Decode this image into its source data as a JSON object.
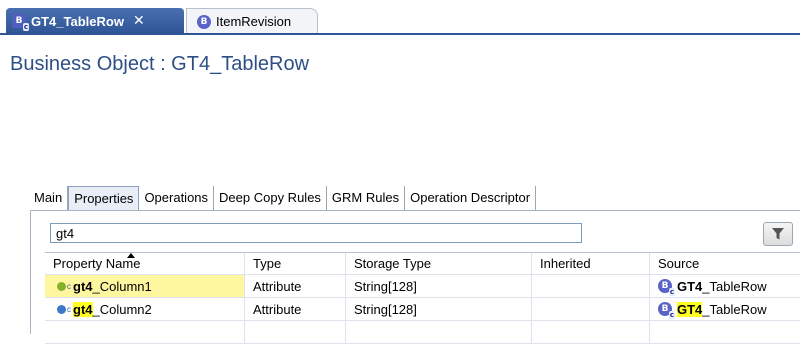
{
  "editor_tabs": [
    {
      "label": "GT4_TableRow",
      "icon": "business-object-icon",
      "active": true
    },
    {
      "label": "ItemRevision",
      "icon": "business-object-icon",
      "active": false
    }
  ],
  "page_title": "Business Object : GT4_TableRow",
  "property_tabs": [
    {
      "label": "Main"
    },
    {
      "label": "Properties",
      "selected": true
    },
    {
      "label": "Operations"
    },
    {
      "label": "Deep Copy Rules"
    },
    {
      "label": "GRM Rules"
    },
    {
      "label": "Operation Descriptor"
    }
  ],
  "search": {
    "value": "gt4"
  },
  "table": {
    "columns": [
      "Property Name",
      "Type",
      "Storage Type",
      "Inherited",
      "Source"
    ],
    "rows": [
      {
        "name_match": "gt4",
        "name_rest": "_Column1",
        "type": "Attribute",
        "storage_type": "String[128]",
        "inherited": "",
        "source_match": "GT4",
        "source_rest": "_TableRow",
        "selected": true
      },
      {
        "name_match": "gt4",
        "name_rest": "_Column2",
        "type": "Attribute",
        "storage_type": "String[128]",
        "inherited": "",
        "source_match": "GT4",
        "source_rest": "_TableRow",
        "selected": false
      }
    ]
  },
  "colors": {
    "title": "#2e4f86",
    "active_tab": "#2f5597",
    "highlight": "#ffff22",
    "selected_row": "#fff7a0"
  }
}
